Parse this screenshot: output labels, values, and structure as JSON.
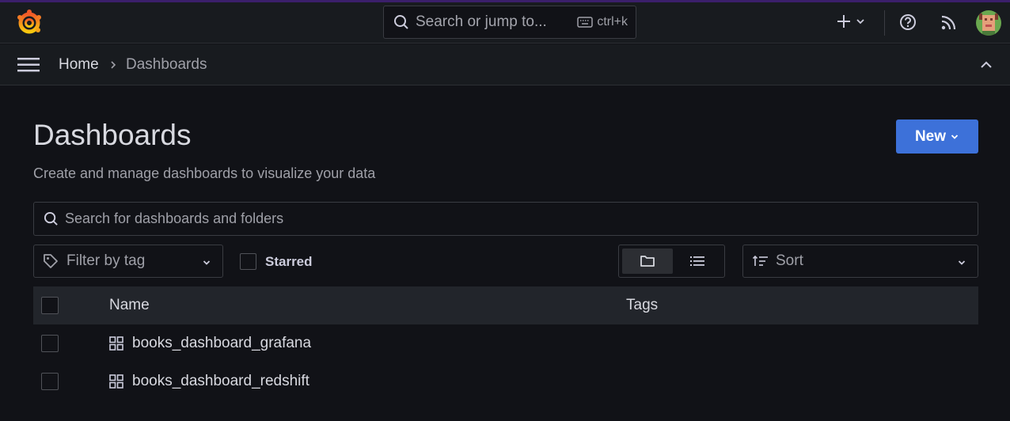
{
  "topbar": {
    "search_placeholder": "Search or jump to...",
    "shortcut": "ctrl+k"
  },
  "navbar": {
    "breadcrumb_home": "Home",
    "breadcrumb_current": "Dashboards"
  },
  "page": {
    "title": "Dashboards",
    "subtitle": "Create and manage dashboards to visualize your data",
    "new_button": "New"
  },
  "filters": {
    "search_placeholder": "Search for dashboards and folders",
    "tag_placeholder": "Filter by tag",
    "starred_label": "Starred",
    "sort_placeholder": "Sort"
  },
  "table": {
    "columns": [
      "Name",
      "Tags"
    ],
    "rows": [
      {
        "name": "books_dashboard_grafana"
      },
      {
        "name": "books_dashboard_redshift"
      }
    ]
  },
  "colors": {
    "accent": "#3d71d9",
    "background": "#111217",
    "panel": "#181b1f"
  }
}
